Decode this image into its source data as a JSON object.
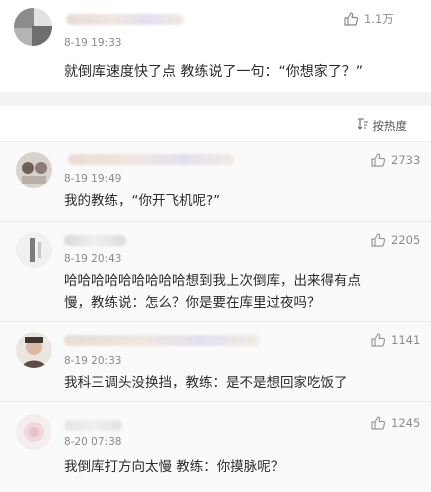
{
  "post": {
    "timestamp": "8-19 19:33",
    "like_count": "1.1万",
    "text": "就倒库速度快了点 教练说了一句：“你想家了？”"
  },
  "sort": {
    "label": "按热度",
    "icon": "sort-icon"
  },
  "comments": [
    {
      "timestamp": "8-19 19:49",
      "likes": "2733",
      "text": "我的教练，“你开飞机呢?”"
    },
    {
      "timestamp": "8-19 20:43",
      "likes": "2205",
      "line1": "哈哈哈哈哈哈哈哈哈想到我上次倒库，出来得有点",
      "line2": "慢，教练说：怎么？你是要在库里过夜吗？"
    },
    {
      "timestamp": "8-19 20:33",
      "likes": "1141",
      "text": "我科三调头没换挡，教练：是不是想回家吃饭了"
    },
    {
      "timestamp": "8-20 07:38",
      "likes": "1245",
      "text": "我倒库打方向太慢 教练：你摸脉呢？"
    }
  ],
  "colors": {
    "text": "#2b2b2b",
    "meta": "#8a8a8a",
    "divider": "#f2f2f2",
    "comment_bg": "#fafafa"
  }
}
